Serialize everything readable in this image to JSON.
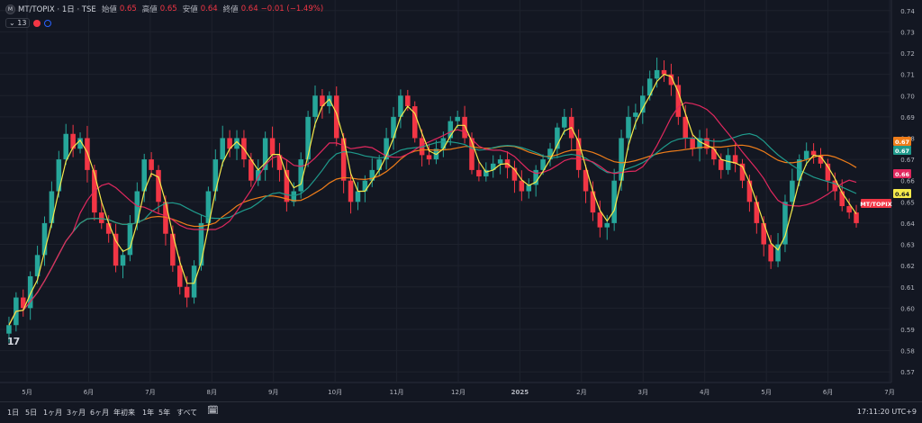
{
  "header": {
    "symbol": "MT/TOPIX · 1日 · TSE",
    "open_label": "始値",
    "open_value": "0.65",
    "high_label": "高値",
    "high_value": "0.65",
    "low_label": "安値",
    "low_value": "0.64",
    "close_label": "終値",
    "close_value": "0.64",
    "change": "−0.01 (−1.49%)"
  },
  "indicator_count": "13",
  "timeframes": [
    "1日",
    "5日",
    "1ヶ月",
    "3ヶ月",
    "6ヶ月",
    "年初来",
    "1年",
    "5年",
    "すべて"
  ],
  "clock": "17:11:20 UTC+9",
  "colors": {
    "up": "#26a69a",
    "down": "#f23645",
    "ma_yellow": "#f5e94b",
    "ma_pink": "#e0285e",
    "ma_teal": "#1f9a8c",
    "ma_orange": "#ef7d1a"
  },
  "chart_data": {
    "type": "candlestick",
    "x_ticks": [
      "5月",
      "6月",
      "7月",
      "8月",
      "9月",
      "10月",
      "11月",
      "12月",
      "2025",
      "2月",
      "3月",
      "4月",
      "5月",
      "6月",
      "7月"
    ],
    "y_ticks": [
      0.57,
      0.58,
      0.59,
      0.6,
      0.61,
      0.62,
      0.63,
      0.64,
      0.65,
      0.66,
      0.67,
      0.68,
      0.69,
      0.7,
      0.71,
      0.72,
      0.73,
      0.74
    ],
    "ylim": [
      0.565,
      0.745
    ],
    "closes": [
      0.592,
      0.605,
      0.6,
      0.615,
      0.625,
      0.64,
      0.655,
      0.67,
      0.682,
      0.675,
      0.68,
      0.665,
      0.645,
      0.64,
      0.635,
      0.62,
      0.625,
      0.64,
      0.655,
      0.67,
      0.665,
      0.65,
      0.635,
      0.62,
      0.61,
      0.605,
      0.62,
      0.64,
      0.655,
      0.67,
      0.68,
      0.675,
      0.68,
      0.67,
      0.66,
      0.665,
      0.68,
      0.672,
      0.665,
      0.65,
      0.655,
      0.67,
      0.69,
      0.7,
      0.695,
      0.7,
      0.68,
      0.66,
      0.65,
      0.655,
      0.66,
      0.665,
      0.67,
      0.68,
      0.69,
      0.7,
      0.695,
      0.68,
      0.672,
      0.67,
      0.675,
      0.68,
      0.688,
      0.69,
      0.68,
      0.665,
      0.662,
      0.665,
      0.668,
      0.67,
      0.666,
      0.66,
      0.655,
      0.658,
      0.665,
      0.67,
      0.675,
      0.685,
      0.69,
      0.68,
      0.665,
      0.655,
      0.645,
      0.638,
      0.64,
      0.66,
      0.68,
      0.69,
      0.692,
      0.7,
      0.708,
      0.712,
      0.71,
      0.705,
      0.69,
      0.68,
      0.675,
      0.68,
      0.675,
      0.67,
      0.665,
      0.672,
      0.668,
      0.66,
      0.65,
      0.64,
      0.63,
      0.622,
      0.63,
      0.65,
      0.66,
      0.67,
      0.674,
      0.672,
      0.668,
      0.66,
      0.655,
      0.648,
      0.645,
      0.64
    ],
    "series": [
      {
        "name": "MT/TOPIX",
        "last": "0.64"
      }
    ],
    "price_labels": [
      {
        "value": 0.67,
        "color": "#ef7d1a",
        "text": "0.67"
      },
      {
        "value": 0.67,
        "color": "#1f9a8c",
        "text": "0.67"
      },
      {
        "value": 0.66,
        "color": "#e0285e",
        "text": "0.66"
      },
      {
        "value": 0.64,
        "color": "#f5e94b",
        "text": "0.64"
      },
      {
        "value": 0.64,
        "color": "#f23645",
        "text": "MT/TOPIX"
      }
    ]
  }
}
